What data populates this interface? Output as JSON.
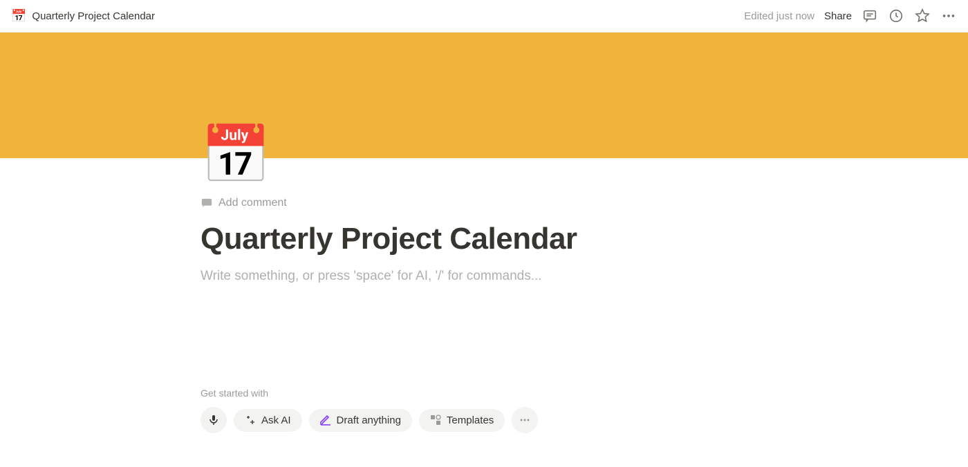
{
  "topbar": {
    "icon": "📅",
    "title": "Quarterly Project Calendar",
    "edited_text": "Edited just now",
    "share_text": "Share"
  },
  "page": {
    "icon": "📅",
    "add_comment": "Add comment",
    "title": "Quarterly Project Calendar",
    "placeholder": "Write something, or press 'space' for AI, '/' for commands..."
  },
  "get_started": {
    "label": "Get started with",
    "ask_ai": "Ask AI",
    "draft": "Draft anything",
    "templates": "Templates"
  },
  "cover": {
    "color": "#f0b43c"
  }
}
